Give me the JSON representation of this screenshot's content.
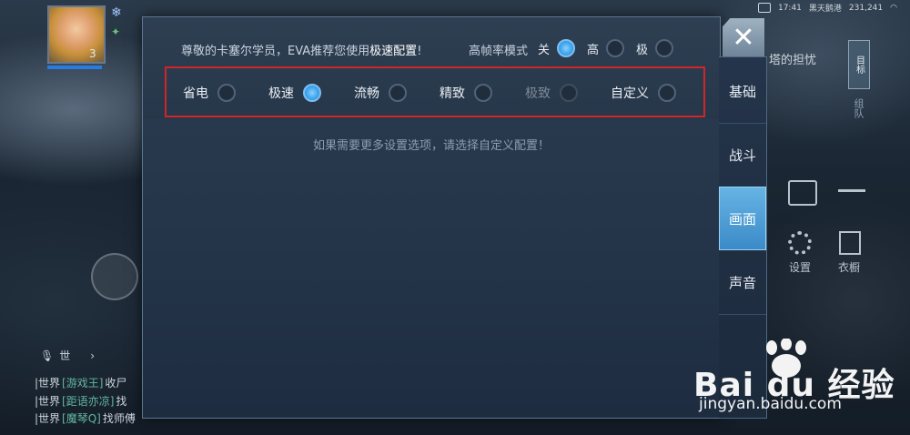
{
  "background": {
    "hero_level": "3",
    "right_hint": "塔的担忧",
    "target_label": "目标",
    "team_label": "组队",
    "settings_label": "设置",
    "wardrobe_label": "衣橱",
    "status": {
      "time": "17:41",
      "location": "黑天鹅港",
      "coords": "231,241"
    },
    "mic_label": "世",
    "chat": [
      {
        "channel": "|世界",
        "user": "[游戏王]",
        "msg": "收尸"
      },
      {
        "channel": "|世界",
        "user": "[距语亦凉]",
        "msg": "找"
      },
      {
        "channel": "|世界",
        "user": "[魔琴Q]",
        "msg": "找师傅"
      }
    ]
  },
  "panel": {
    "eva_prefix": "尊敬的卡塞尔学员，EVA推荐您使用",
    "eva_highlight": "极速配置",
    "eva_suffix": "!",
    "hfr_label": "高帧率模式",
    "hfr_options": [
      {
        "label": "关",
        "selected": true
      },
      {
        "label": "高",
        "selected": false
      },
      {
        "label": "极",
        "selected": false
      }
    ],
    "presets": [
      {
        "label": "省电",
        "selected": false,
        "enabled": true
      },
      {
        "label": "极速",
        "selected": true,
        "enabled": true
      },
      {
        "label": "流畅",
        "selected": false,
        "enabled": true
      },
      {
        "label": "精致",
        "selected": false,
        "enabled": true
      },
      {
        "label": "极致",
        "selected": false,
        "enabled": false
      },
      {
        "label": "自定义",
        "selected": false,
        "enabled": true
      }
    ],
    "hint": "如果需要更多设置选项，请选择自定义配置！"
  },
  "tabs": [
    {
      "label": "基础",
      "active": false
    },
    {
      "label": "战斗",
      "active": false
    },
    {
      "label": "画面",
      "active": true
    },
    {
      "label": "声音",
      "active": false
    }
  ],
  "close_icon": "close-x-icon",
  "watermark": {
    "brand": "Bai du 经验",
    "url": "jingyan.baidu.com"
  },
  "colors": {
    "accent": "#3ea5ee",
    "highlight_box": "#d0252a",
    "active_tab": "#4fa0d8"
  }
}
